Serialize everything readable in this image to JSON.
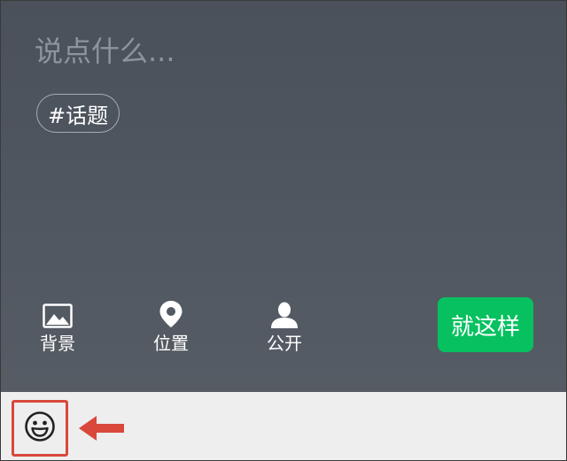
{
  "composer": {
    "placeholder": "说点什么...",
    "topic_label": "#话题"
  },
  "toolbar": {
    "items": [
      {
        "label": "背景",
        "icon": "image-icon"
      },
      {
        "label": "位置",
        "icon": "location-pin-icon"
      },
      {
        "label": "公开",
        "icon": "person-icon"
      }
    ],
    "submit_label": "就这样"
  },
  "bottom_bar": {
    "emoji_icon": "smiley-face-icon",
    "annotation_icon": "arrow-left-icon"
  },
  "colors": {
    "composer_background": "#4f5761",
    "submit_green": "#07c160",
    "bottom_bar": "#eeeeee",
    "highlight_red": "#d9483b"
  }
}
